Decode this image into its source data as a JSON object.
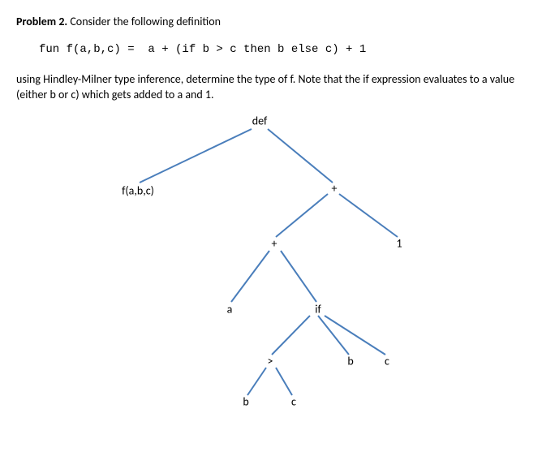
{
  "problem": {
    "label": "Problem 2.",
    "intro": "Consider the following definition",
    "code": "fun f(a,b,c) =  a + (if b > c then b else c) + 1",
    "desc": "using Hindley-Milner type inference, determine the type of f. Note that the if expression evaluates to a value (either b or c) which gets added to a and 1."
  },
  "tree": {
    "root": "def",
    "left_child": "f(a,b,c)",
    "plus1": "+",
    "plus2": "+",
    "one": "1",
    "a": "a",
    "if": "if",
    "gt": ">",
    "b1": "b",
    "c1": "c",
    "b2": "b",
    "c2": "c"
  }
}
